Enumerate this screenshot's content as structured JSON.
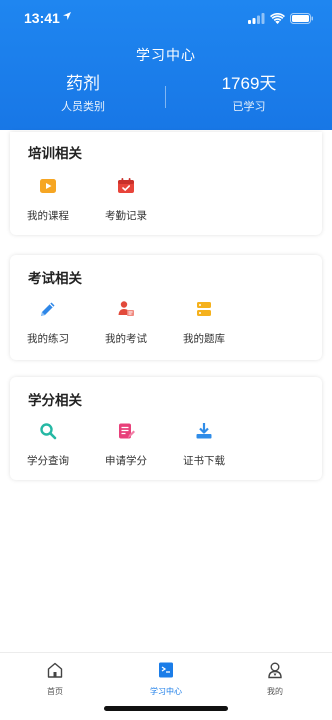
{
  "status_bar": {
    "time": "13:41"
  },
  "header": {
    "title": "学习中心",
    "category_value": "药剂",
    "category_label": "人员类别",
    "days_value": "1769天",
    "days_label": "已学习"
  },
  "sections": [
    {
      "title": "培训相关",
      "items": [
        {
          "label": "我的课程",
          "icon": "play-video-icon",
          "color": "#f6a623"
        },
        {
          "label": "考勤记录",
          "icon": "calendar-icon",
          "color": "#e8443a"
        }
      ]
    },
    {
      "title": "考试相关",
      "items": [
        {
          "label": "我的练习",
          "icon": "pencil-icon",
          "color": "#2f87e8"
        },
        {
          "label": "我的考试",
          "icon": "exam-person-icon",
          "color": "#e24a3b"
        },
        {
          "label": "我的题库",
          "icon": "question-bank-icon",
          "color": "#f5b11c"
        }
      ]
    },
    {
      "title": "学分相关",
      "items": [
        {
          "label": "学分查询",
          "icon": "search-icon",
          "color": "#25b8a4"
        },
        {
          "label": "申请学分",
          "icon": "apply-form-icon",
          "color": "#e8407a"
        },
        {
          "label": "证书下载",
          "icon": "download-icon",
          "color": "#2f8ce8"
        }
      ]
    }
  ],
  "tabbar": {
    "tabs": [
      {
        "label": "首页",
        "icon": "home-icon"
      },
      {
        "label": "学习中心",
        "icon": "study-center-icon",
        "active": true
      },
      {
        "label": "我的",
        "icon": "profile-icon"
      }
    ]
  },
  "colors": {
    "brand_blue": "#1877e6",
    "active_tab": "#1b7de8"
  }
}
